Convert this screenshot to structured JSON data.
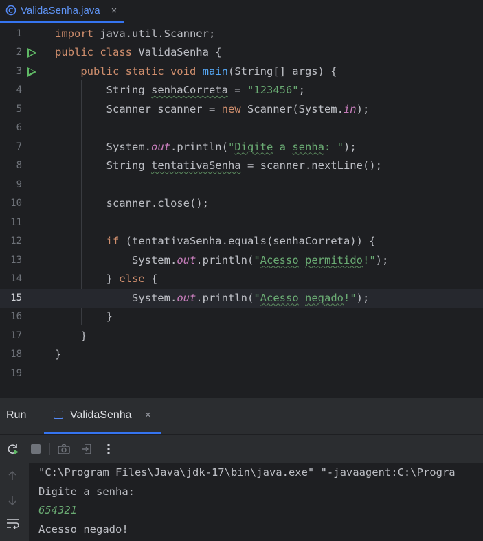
{
  "editor_tab": {
    "filename": "ValidaSenha.java",
    "close": "×"
  },
  "lines": [
    {
      "n": "1",
      "html": "<span class=\"kw\">import</span> java.util.Scanner;"
    },
    {
      "n": "2",
      "html": "<span class=\"kw\">public class</span> ValidaSenha {",
      "run": true
    },
    {
      "n": "3",
      "html": "    <span class=\"kw\">public static void</span> <span class=\"fn\">main</span>(String[] args) {",
      "run": true
    },
    {
      "n": "4",
      "html": "        String <span class=\"wavy\">senhaCorreta</span> = <span class=\"str\">\"123456\"</span>;"
    },
    {
      "n": "5",
      "html": "        Scanner scanner = <span class=\"kw\">new</span> Scanner(System.<span class=\"field\">in</span>);"
    },
    {
      "n": "6",
      "html": ""
    },
    {
      "n": "7",
      "html": "        System.<span class=\"field\">out</span>.println(<span class=\"str\">\"<span class=\"wavy\">Digite</span> a <span class=\"wavy\">senha</span>: \"</span>);"
    },
    {
      "n": "8",
      "html": "        String <span class=\"wavy\">tentativaSenha</span> = scanner.nextLine();"
    },
    {
      "n": "9",
      "html": ""
    },
    {
      "n": "10",
      "html": "        scanner.close();"
    },
    {
      "n": "11",
      "html": ""
    },
    {
      "n": "12",
      "html": "        <span class=\"kw\">if</span> (tentativaSenha.equals(senhaCorreta)) {"
    },
    {
      "n": "13",
      "html": "            System.<span class=\"field\">out</span>.println(<span class=\"str\">\"<span class=\"wavy\">Acesso</span> <span class=\"wavy\">permitido</span>!\"</span>);"
    },
    {
      "n": "14",
      "html": "        } <span class=\"kw\">else</span> {"
    },
    {
      "n": "15",
      "html": "            System.<span class=\"field\">out</span>.println(<span class=\"str\">\"<span class=\"wavy\">Acesso</span> <span class=\"wavy\">negado</span>!\"</span>);",
      "current": true
    },
    {
      "n": "16",
      "html": "        }"
    },
    {
      "n": "17",
      "html": "    }"
    },
    {
      "n": "18",
      "html": "}"
    },
    {
      "n": "19",
      "html": ""
    }
  ],
  "run_panel": {
    "label": "Run",
    "tab": "ValidaSenha",
    "tab_close": "×",
    "console": [
      {
        "text": "\"C:\\Program Files\\Java\\jdk-17\\bin\\java.exe\" \"-javaagent:C:\\Progra",
        "type": "output"
      },
      {
        "text": "Digite a senha:",
        "type": "output"
      },
      {
        "text": "654321",
        "type": "input"
      },
      {
        "text": "Acesso negado!",
        "type": "output"
      }
    ]
  },
  "colors": {
    "keyword": "#cf8e6d",
    "string": "#6aab73",
    "function": "#56a8f5",
    "field": "#c77dbb",
    "accent": "#3574f0",
    "run_green": "#5fb865"
  }
}
